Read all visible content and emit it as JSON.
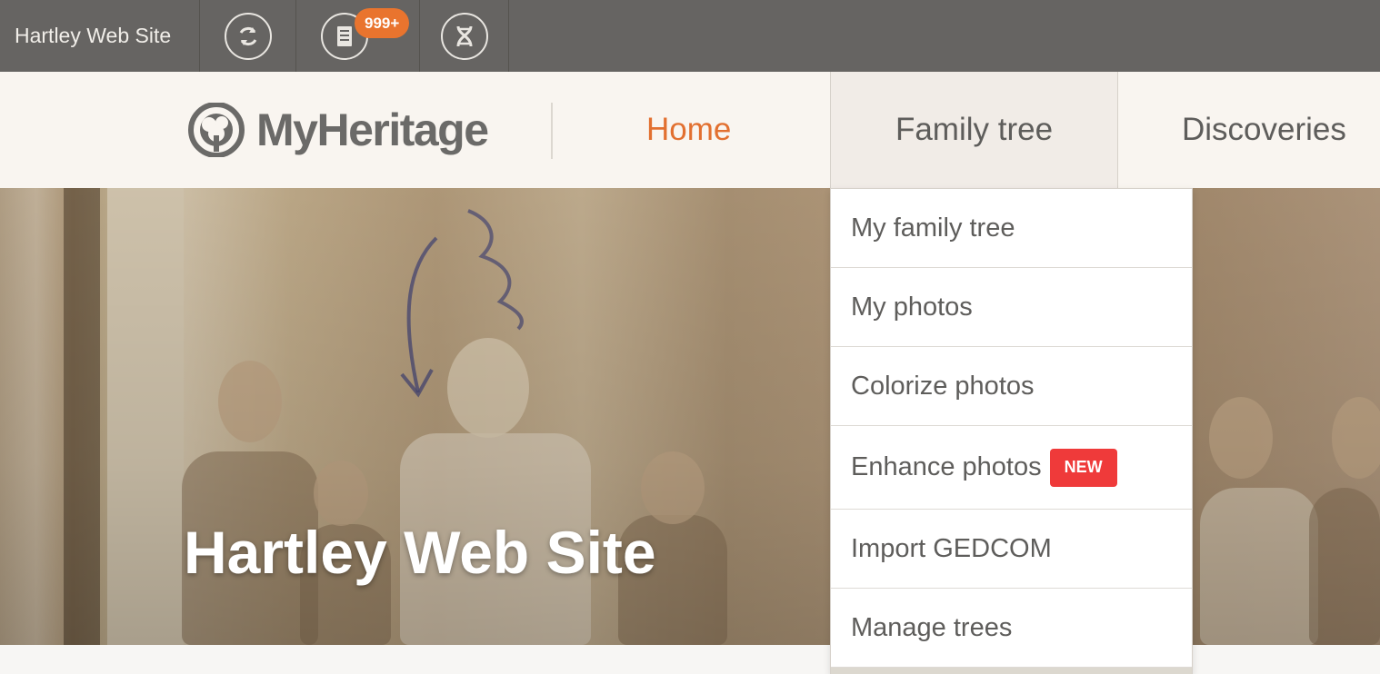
{
  "topbar": {
    "site_name": "Hartley Web Site",
    "notifications_badge": "999+",
    "icons": [
      "sync-icon",
      "document-icon",
      "dna-icon"
    ]
  },
  "header": {
    "logo_text": "MyHeritage",
    "nav": {
      "home": "Home",
      "family_tree": "Family tree",
      "discoveries": "Discoveries"
    }
  },
  "hero": {
    "title": "Hartley Web Site"
  },
  "dropdown": {
    "items": [
      {
        "label": "My family tree"
      },
      {
        "label": "My photos"
      },
      {
        "label": "Colorize photos"
      },
      {
        "label": "Enhance photos",
        "badge": "NEW"
      },
      {
        "label": "Import GEDCOM"
      },
      {
        "label": "Manage trees"
      }
    ]
  },
  "colors": {
    "topbar": "#666462",
    "accent_orange": "#e27030",
    "badge_orange": "#e9742e",
    "new_badge_red": "#ef3a3a",
    "header_bg": "#f9f5f0"
  }
}
